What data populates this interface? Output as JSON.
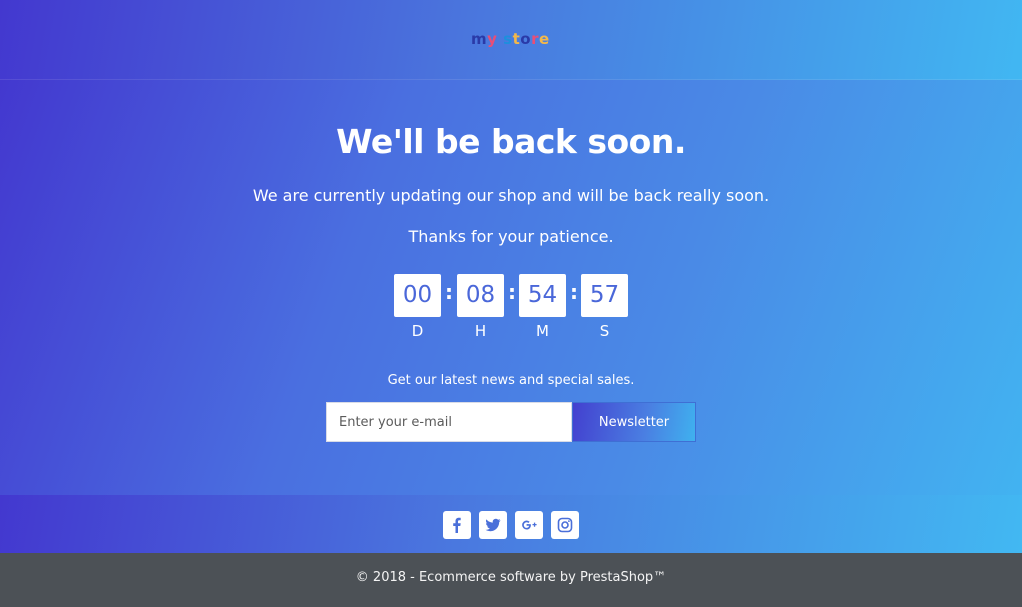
{
  "header": {
    "logo": {
      "letters": [
        "m",
        "y",
        " ",
        "s",
        "t",
        "o",
        "r",
        "e"
      ],
      "colors": [
        "#2a3aa8",
        "#e94e77",
        "#ffffff",
        "#1d8fdd",
        "#f3b84a",
        "#2a3aa8",
        "#e94e77",
        "#f3b84a"
      ]
    }
  },
  "main": {
    "title": "We'll be back soon.",
    "message": "We are currently updating our shop and will be back really soon.",
    "thanks": "Thanks for your patience.",
    "countdown": {
      "days": "00",
      "hours": "08",
      "minutes": "54",
      "seconds": "57",
      "labels": {
        "days": "D",
        "hours": "H",
        "minutes": "M",
        "seconds": "S"
      },
      "separator": ":"
    },
    "newsletter": {
      "text": "Get our latest news and special sales.",
      "placeholder": "Enter your e-mail",
      "button_label": "Newsletter"
    }
  },
  "social": [
    {
      "name": "facebook",
      "icon": "facebook-icon"
    },
    {
      "name": "twitter",
      "icon": "twitter-icon"
    },
    {
      "name": "google-plus",
      "icon": "google-plus-icon"
    },
    {
      "name": "instagram",
      "icon": "instagram-icon"
    }
  ],
  "footer": {
    "copyright": "© 2018 - Ecommerce software by PrestaShop™"
  },
  "colors": {
    "gradient_start": "#4338cf",
    "gradient_end": "#42b8f2",
    "footer_bg": "#4c5156",
    "countdown_text": "#4a67d9"
  }
}
